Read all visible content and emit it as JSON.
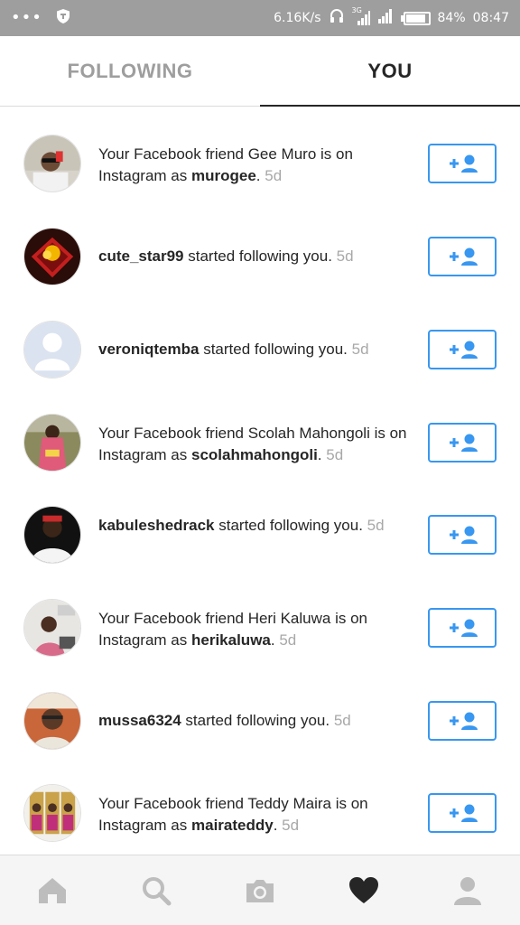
{
  "status_bar": {
    "network_speed": "6.16K/s",
    "network_type": "3G",
    "battery": "84%",
    "time": "08:47"
  },
  "tabs": [
    {
      "label": "FOLLOWING",
      "active": false
    },
    {
      "label": "YOU",
      "active": true
    }
  ],
  "notifications": [
    {
      "type": "facebook_friend",
      "prefix": "Your Facebook friend Gee Muro is on Instagram as ",
      "username": "murogee",
      "suffix": ".",
      "time": "5d"
    },
    {
      "type": "follow",
      "username": "cute_star99",
      "prefix": "",
      "suffix": " started following you.",
      "time": "5d"
    },
    {
      "type": "follow",
      "username": "veroniqtemba",
      "prefix": "",
      "suffix": " started following you.",
      "time": "5d"
    },
    {
      "type": "facebook_friend",
      "prefix": "Your Facebook friend Scolah Mahongoli is on Instagram as ",
      "username": "scolahmahongoli",
      "suffix": ".",
      "time": "5d"
    },
    {
      "type": "follow",
      "username": "kabuleshedrack",
      "prefix": "",
      "suffix": " started following you.",
      "time": "5d"
    },
    {
      "type": "facebook_friend",
      "prefix": "Your Facebook friend Heri Kaluwa is on Instagram as ",
      "username": "herikaluwa",
      "suffix": ".",
      "time": "5d"
    },
    {
      "type": "follow",
      "username": "mussa6324",
      "prefix": "",
      "suffix": " started following you.",
      "time": "5d"
    },
    {
      "type": "facebook_friend",
      "prefix": "Your Facebook friend Teddy Maira is on Instagram as ",
      "username": "mairateddy",
      "suffix": ".",
      "time": "5d"
    }
  ],
  "follow_button_icon": "add-person-icon",
  "accent_color": "#3897f0",
  "bottom_nav": [
    {
      "icon": "home-icon",
      "active": false
    },
    {
      "icon": "search-icon",
      "active": false
    },
    {
      "icon": "camera-icon",
      "active": false
    },
    {
      "icon": "heart-icon",
      "active": true
    },
    {
      "icon": "profile-icon",
      "active": false
    }
  ]
}
